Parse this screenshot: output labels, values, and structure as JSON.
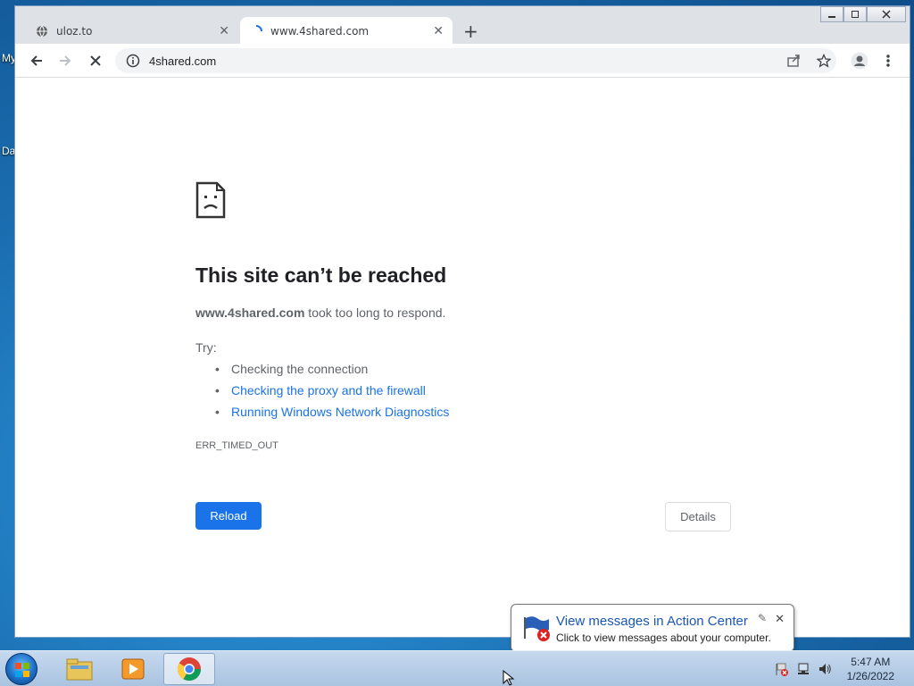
{
  "desktop": {
    "labels": [
      "My",
      "Da"
    ]
  },
  "browser": {
    "tabs": [
      {
        "title": "uloz.to",
        "active": false
      },
      {
        "title": "www.4shared.com",
        "active": true
      }
    ],
    "new_tab_label": "+",
    "address": "4shared.com"
  },
  "error_page": {
    "headline": "This site can’t be reached",
    "host": "www.4shared.com",
    "message_rest": " took too long to respond.",
    "try_label": "Try:",
    "suggestions": [
      {
        "text": "Checking the connection",
        "link": false
      },
      {
        "text": "Checking the proxy and the firewall",
        "link": true
      },
      {
        "text": "Running Windows Network Diagnostics",
        "link": true
      }
    ],
    "error_code": "ERR_TIMED_OUT",
    "reload_label": "Reload",
    "details_label": "Details"
  },
  "balloon": {
    "title": "View messages in Action Center",
    "text": "Click to view messages about your computer."
  },
  "taskbar": {
    "time": "5:47 AM",
    "date": "1/26/2022"
  },
  "colors": {
    "accent": "#1a73e8",
    "text": "#202124",
    "secondary": "#5f6368"
  }
}
